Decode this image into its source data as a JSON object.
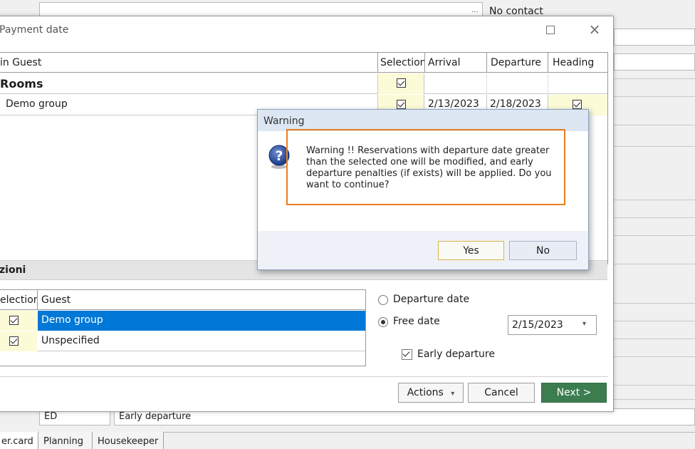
{
  "background": {
    "dots_label": "...",
    "contact_text": "No contact",
    "code_value": "ED",
    "code_description": "Early departure",
    "tabs": [
      {
        "label": "er.card"
      },
      {
        "label": "Planning"
      },
      {
        "label": "Housekeeper"
      }
    ]
  },
  "dialog": {
    "title": "Payment date",
    "grid": {
      "columns": [
        "in Guest",
        "Selection",
        "Arrival",
        "Departure",
        "Heading"
      ],
      "group_row": {
        "label": "Rooms",
        "selected": true
      },
      "rows": [
        {
          "guest": "Demo group",
          "selected": true,
          "arrival": "2/13/2023",
          "departure": "2/18/2023",
          "heading": true
        }
      ]
    },
    "options_section": {
      "title": "zioni",
      "columns": [
        "election",
        "Guest"
      ],
      "rows": [
        {
          "guest": "Demo group",
          "selected": true,
          "highlighted": true
        },
        {
          "guest": "Unspecified",
          "selected": true,
          "highlighted": false
        }
      ],
      "radio_departure": "Departure date",
      "radio_free": "Free date",
      "radio_selected": "Free date",
      "date_value": "2/15/2023",
      "early_departure_label": "Early departure",
      "early_departure_checked": true
    },
    "buttons": {
      "actions": "Actions",
      "cancel": "Cancel",
      "next": "Next >"
    }
  },
  "warning": {
    "title": "Warning",
    "message": "Warning !! Reservations with departure date greater than the selected one will be modified, and early departure penalties (if exists) will be applied. Do you want to continue?",
    "yes": "Yes",
    "no": "No"
  },
  "colors": {
    "selection_blue": "#0078d7",
    "highlight_outline": "#e87e20",
    "next_button": "#3c7d50",
    "checkbox_cell": "#fcfbd8"
  }
}
